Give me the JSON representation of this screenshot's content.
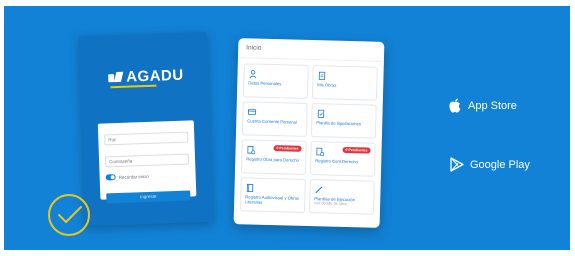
{
  "colors": {
    "banner_bg": "#1282d6",
    "accent_yellow": "#e7c61e",
    "badge_red": "#e6323a",
    "link_blue": "#1b7bd0"
  },
  "login": {
    "brand": "AGADU",
    "user_placeholder": "Ruc",
    "password_placeholder": "Contraseña",
    "remember_label": "Recordar inicio",
    "button_label": "Ingresar"
  },
  "home": {
    "title": "Inicio",
    "tiles": [
      {
        "icon": "person-icon",
        "label": "Datos Personales",
        "sub": ""
      },
      {
        "icon": "document-icon",
        "label": "Mis Obras",
        "sub": ""
      },
      {
        "icon": "card-icon",
        "label": "Cuenta Corriente Personal",
        "sub": ""
      },
      {
        "icon": "document-check-icon",
        "label": "Planilla de liquidaciones",
        "sub": ""
      },
      {
        "icon": "register-icon",
        "label": "Registro Obra para Derecho",
        "sub": "",
        "badge": "0 Pendientes"
      },
      {
        "icon": "register-icon",
        "label": "Registro Cont.Derecho",
        "sub": "",
        "badge": "0 Pendientes"
      },
      {
        "icon": "book-icon",
        "label": "Registro Audiovisual y Obras Literarias",
        "sub": ""
      },
      {
        "icon": "pen-icon",
        "label": "Planillas de Ejecución",
        "sub": "con detalle de obra"
      }
    ]
  },
  "stores": {
    "app_store": "App Store",
    "google_play": "Google Play"
  }
}
